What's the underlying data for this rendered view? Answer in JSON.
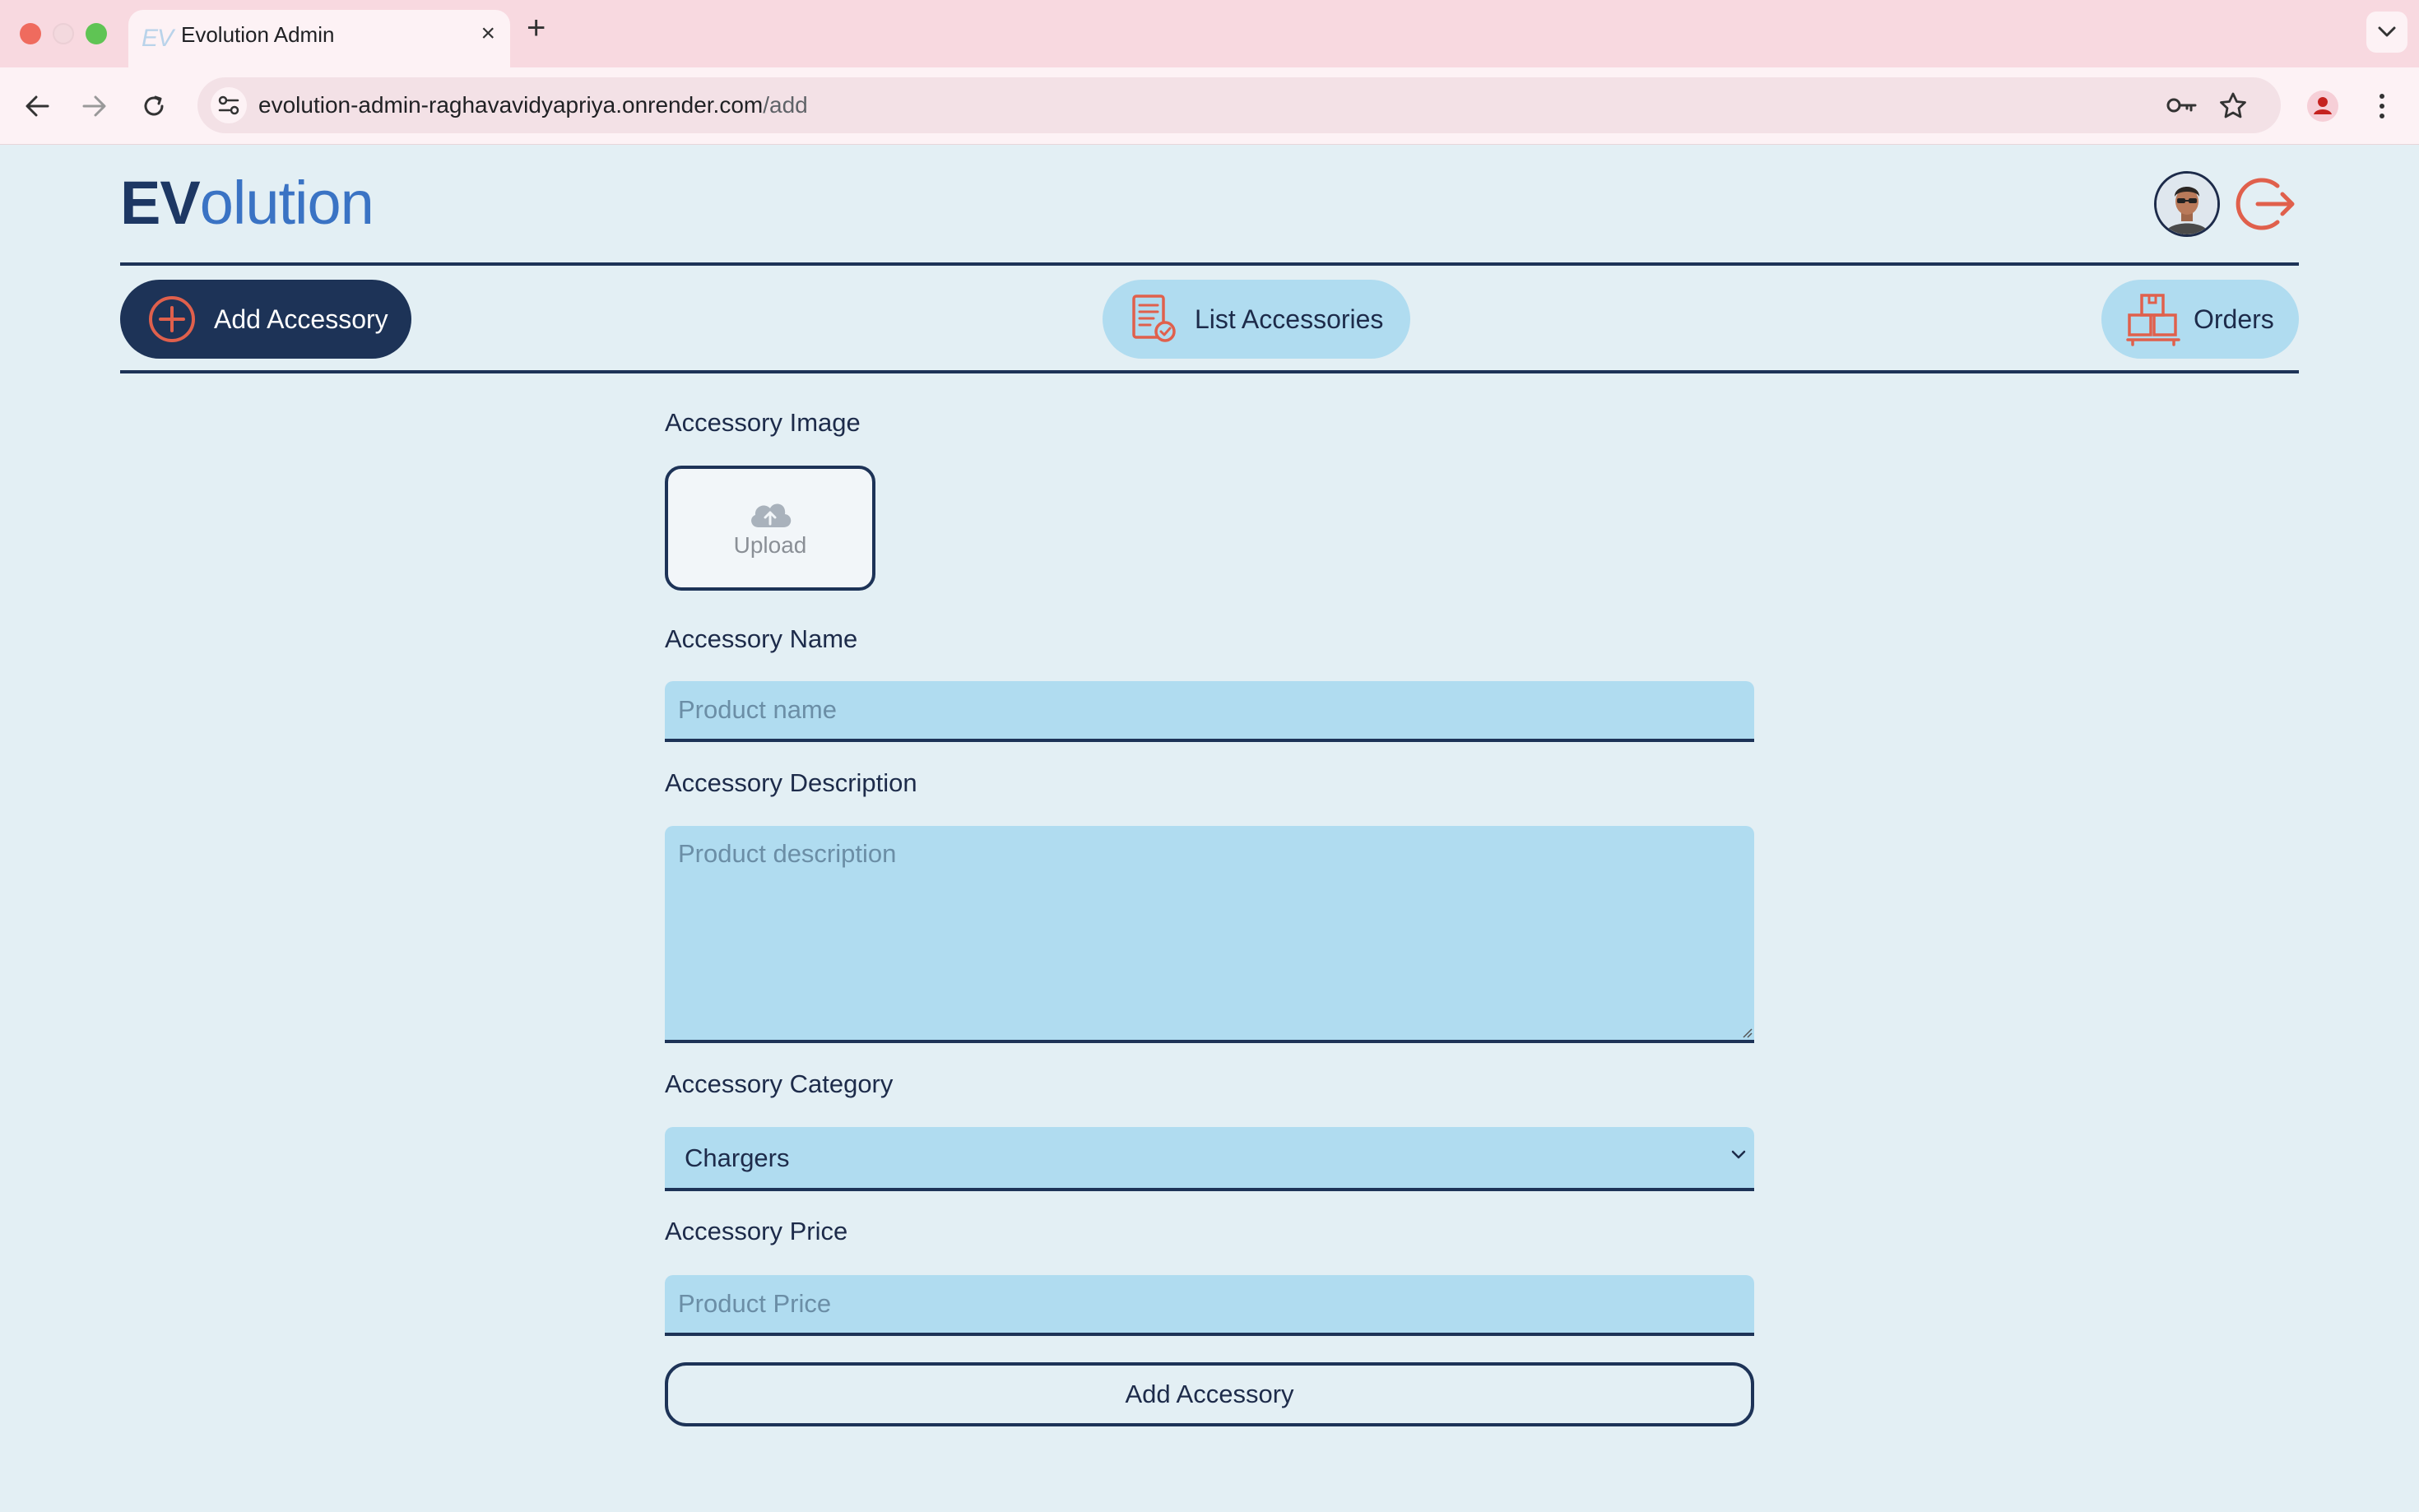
{
  "browser": {
    "tab_favicon": "EV",
    "tab_title": "Evolution Admin",
    "url_host": "evolution-admin-raghavavidyapriya.onrender.com",
    "url_path": "/add"
  },
  "header": {
    "logo_primary": "EV",
    "logo_secondary": "olution",
    "avatar_icon": "user-avatar",
    "logout_icon": "logout-icon"
  },
  "nav": {
    "add_accessory": "Add Accessory",
    "list_accessories": "List Accessories",
    "orders": "Orders"
  },
  "form": {
    "image_label": "Accessory Image",
    "upload_text": "Upload",
    "name_label": "Accessory Name",
    "name_placeholder": "Product name",
    "description_label": "Accessory Description",
    "description_placeholder": "Product description",
    "category_label": "Accessory Category",
    "category_value": "Chargers",
    "price_label": "Accessory Price",
    "price_placeholder": "Product Price",
    "submit_label": "Add Accessory"
  },
  "colors": {
    "page_bg": "#e3eff4",
    "navy": "#1d3357",
    "light_blue": "#b0dcf0",
    "accent_red": "#e0604c",
    "logo_blue": "#3a73c4"
  }
}
